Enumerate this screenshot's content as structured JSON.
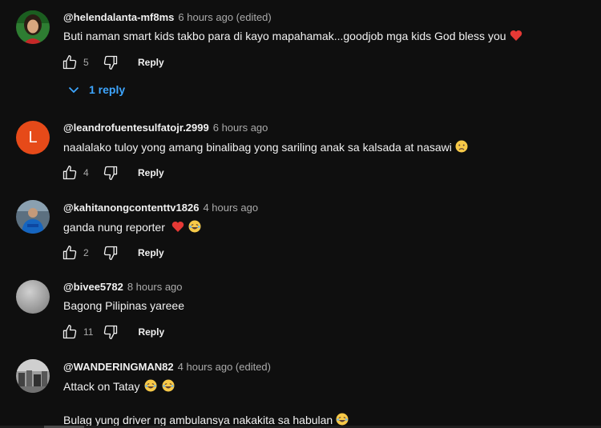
{
  "comments": [
    {
      "handle": "@helendalanta-mf8ms",
      "time": "6 hours ago (edited)",
      "text": "Buti naman smart kids takbo para di kayo mapahamak...goodjob mga kids God bless you",
      "emojis": [
        "red-heart"
      ],
      "likes": "5",
      "reply_label": "Reply",
      "replies_label": "1 reply",
      "avatar": "photo-woman"
    },
    {
      "handle": "@leandrofuentesulfatojr.2999",
      "time": "6 hours ago",
      "text": "naalalako tuloy yong amang binalibag yong sariling anak sa kalsada at nasawi",
      "emojis": [
        "sad-face"
      ],
      "likes": "4",
      "reply_label": "Reply",
      "avatar_letter": "L",
      "avatar_color": "#e64a19"
    },
    {
      "handle": "@kahitanongcontenttv1826",
      "time": "4 hours ago",
      "text": "ganda nung reporter",
      "emojis": [
        "red-heart",
        "laughing-face"
      ],
      "likes": "2",
      "reply_label": "Reply",
      "avatar": "photo-person-blue"
    },
    {
      "handle": "@bivee5782",
      "time": "8 hours ago",
      "text": "Bagong Pilipinas yareee",
      "emojis": [],
      "likes": "11",
      "reply_label": "Reply",
      "avatar": "photo-grey"
    },
    {
      "handle": "@WANDERINGMAN82",
      "time": "4 hours ago (edited)",
      "text": "Attack on Tatay",
      "emojis": [
        "laughing-face",
        "laughing-face"
      ],
      "text2": "Bulag yung driver ng ambulansya nakakita sa habulan",
      "emojis2": [
        "laughing-face"
      ],
      "avatar": "photo-crowd"
    }
  ],
  "colors": {
    "background": "#0f0f0f",
    "text": "#f1f1f1",
    "secondary_text": "#aaaaaa",
    "link_blue": "#3ea6ff",
    "heart_red": "#e53935",
    "emoji_yellow": "#f7c948"
  }
}
